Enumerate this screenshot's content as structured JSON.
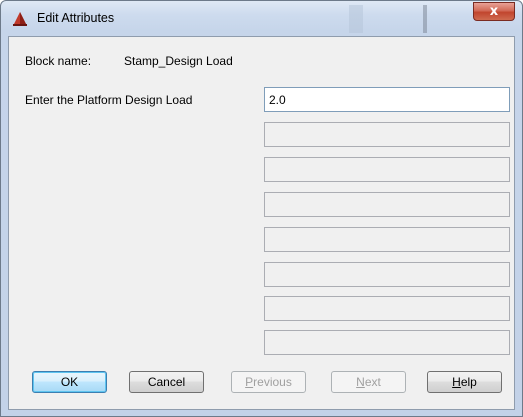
{
  "window": {
    "title": "Edit Attributes",
    "close_label": "x"
  },
  "block": {
    "name_label": "Block name:",
    "name_value": "Stamp_Design Load"
  },
  "attributes": [
    {
      "prompt": "Enter the Platform Design Load",
      "value": "2.0"
    },
    {
      "prompt": "",
      "value": ""
    },
    {
      "prompt": "",
      "value": ""
    },
    {
      "prompt": "",
      "value": ""
    },
    {
      "prompt": "",
      "value": ""
    },
    {
      "prompt": "",
      "value": ""
    },
    {
      "prompt": "",
      "value": ""
    },
    {
      "prompt": "",
      "value": ""
    }
  ],
  "buttons": {
    "ok": "OK",
    "cancel": "Cancel",
    "previous_first": "P",
    "previous_rest": "revious",
    "next_first": "N",
    "next_rest": "ext",
    "help_first": "H",
    "help_rest": "elp"
  },
  "colors": {
    "accent": "#3c7fb1",
    "close": "#c1452e"
  }
}
